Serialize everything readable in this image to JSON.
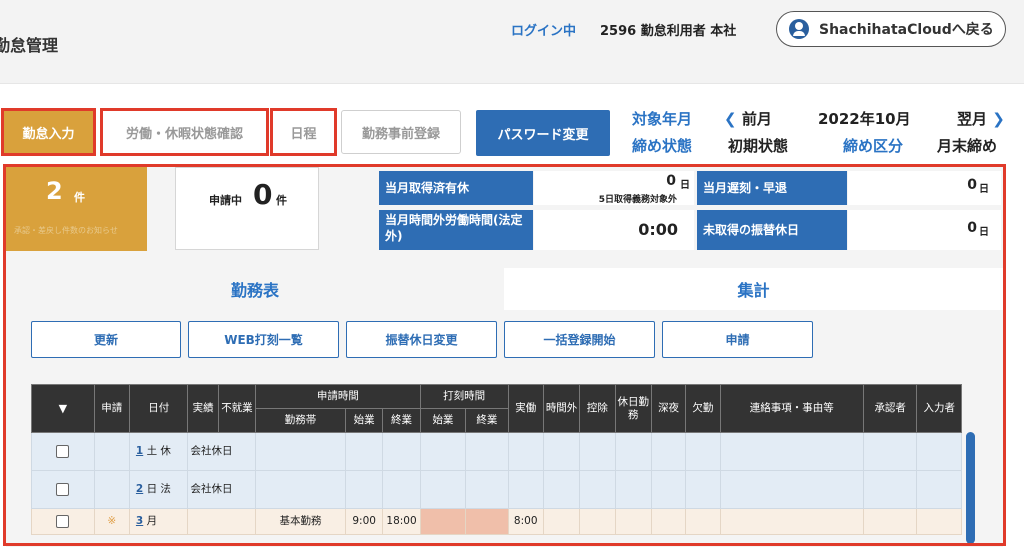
{
  "header": {
    "app_title": "勤怠管理",
    "login_label": "ログイン中",
    "login_user": "2596  勤怠利用者  本社",
    "back_button": "ShachihataCloudへ戻る"
  },
  "nav": {
    "kintai_input": "勤怠入力",
    "roudou_kyuka": "労働・休暇状態確認",
    "nittei": "日程",
    "jizen": "勤務事前登録",
    "password": "パスワード変更"
  },
  "month": {
    "target_label": "対象年月",
    "prev": "前月",
    "prev_arrow": "❮",
    "current": "2022年10月",
    "next": "翌月",
    "next_arrow": "❯",
    "close_status_label": "締め状態",
    "close_status_value": "初期状態",
    "close_type_label": "締め区分",
    "close_type_value": "月末締め"
  },
  "summary": {
    "pending_count": "2",
    "pending_unit": "件",
    "pending_sub": "承認・差戻し件数のお知らせ",
    "applying_prefix": "申請中",
    "applying_count": "0",
    "applying_unit": "件",
    "stats": {
      "paid_leave_label": "当月取得済有休",
      "paid_leave_value": "0",
      "paid_leave_unit": "日",
      "paid_leave_note": "5日取得義務対象外",
      "late_label": "当月遅刻・早退",
      "late_value": "0",
      "late_unit": "日",
      "overtime_label": "当月時間外労働時間(法定外)",
      "overtime_value": "0:00",
      "comp_label": "未取得の振替休日",
      "comp_value": "0",
      "comp_unit": "日"
    }
  },
  "tabs": {
    "kinmu": "勤務表",
    "shukei": "集計"
  },
  "actions": {
    "refresh": "更新",
    "web_list": "WEB打刻一覧",
    "furikae": "振替休日変更",
    "bulk": "一括登録開始",
    "apply": "申請"
  },
  "table": {
    "headers": {
      "sort": "▼",
      "shinsei": "申請",
      "date": "日付",
      "jisseki": "実績",
      "fushugyo": "不就業",
      "shinsei_time": "申請時間",
      "kinmutai": "勤務帯",
      "start": "始業",
      "end": "終業",
      "dakoku": "打刻時間",
      "dakoku_start": "始業",
      "dakoku_end": "終業",
      "jitsudo": "実働",
      "jikangai": "時間外",
      "kojo": "控除",
      "kyujitsu": "休日勤務",
      "shinya": "深夜",
      "kekkin": "欠勤",
      "renraku": "連絡事項・事由等",
      "shoninsha": "承認者",
      "nyuryokusha": "入力者"
    },
    "rows": [
      {
        "day": "1",
        "weekday": "土",
        "type": "休",
        "fushugyo": "会社休日",
        "mark": "",
        "kinmutai": "",
        "start": "",
        "end": "",
        "jitsudo": ""
      },
      {
        "day": "2",
        "weekday": "日",
        "type": "法",
        "fushugyo": "会社休日",
        "mark": "",
        "kinmutai": "",
        "start": "",
        "end": "",
        "jitsudo": ""
      },
      {
        "day": "3",
        "weekday": "月",
        "type": "",
        "fushugyo": "",
        "mark": "※",
        "kinmutai": "基本勤務",
        "start": "9:00",
        "end": "18:00",
        "jitsudo": "8:00"
      }
    ]
  },
  "colors": {
    "accent_blue": "#2e6db4",
    "link_blue": "#2a73c4",
    "highlight_red": "#e03a2a",
    "orange": "#d9a13c",
    "stamp_pink": "#f0bfaa"
  }
}
